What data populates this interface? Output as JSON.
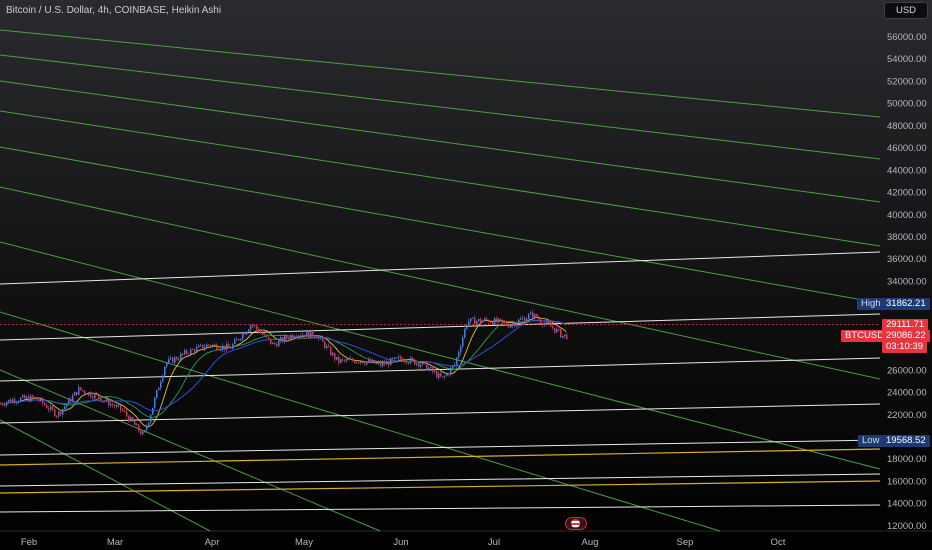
{
  "header": {
    "title": "Bitcoin / U.S. Dollar, 4h, COINBASE, Heikin Ashi",
    "currency_button": "USD"
  },
  "tags": {
    "high_label": "High",
    "high_value": "31862.21",
    "low_label": "Low",
    "low_value": "19568.52",
    "symbol": "BTCUSD",
    "price_a": "29111.71",
    "price_b": "29086.22",
    "countdown": "03:10:39"
  },
  "colors": {
    "background": "#000000",
    "up": "#3f7cf4",
    "down": "#e0304a",
    "trendline_green": "#58b44b",
    "level_white": "#e8e8e8",
    "level_yellow": "#d8b024",
    "ma_fast": "#e3c53a",
    "ma_slow": "#2c4fd8",
    "ma_mid": "#2e9c4d",
    "price_tag": "#e8343f",
    "extreme_tag": "#1e3a74"
  },
  "chart_data": {
    "type": "line",
    "title": "Bitcoin / U.S. Dollar, 4h, COINBASE, Heikin Ashi",
    "x_ticks": [
      "Feb",
      "Mar",
      "Apr",
      "May",
      "Jun",
      "Jul",
      "Aug",
      "Sep",
      "Oct"
    ],
    "y_ticks": [
      "56000.00",
      "54000.00",
      "52000.00",
      "50000.00",
      "48000.00",
      "46000.00",
      "44000.00",
      "42000.00",
      "40000.00",
      "38000.00",
      "36000.00",
      "34000.00",
      "26000.00",
      "24000.00",
      "22000.00",
      "18000.00",
      "16000.00",
      "14000.00",
      "12000.00"
    ],
    "ylim": [
      11500,
      57500
    ],
    "series": [
      {
        "name": "BTCUSD",
        "x": [
          "2023-01-20",
          "2023-01-27",
          "2023-02-03",
          "2023-02-10",
          "2023-02-17",
          "2023-02-24",
          "2023-03-03",
          "2023-03-10",
          "2023-03-13",
          "2023-03-17",
          "2023-03-24",
          "2023-03-31",
          "2023-04-07",
          "2023-04-14",
          "2023-04-21",
          "2023-04-28",
          "2023-05-05",
          "2023-05-12",
          "2023-05-19",
          "2023-05-26",
          "2023-06-02",
          "2023-06-09",
          "2023-06-15",
          "2023-06-19",
          "2023-06-23",
          "2023-06-30",
          "2023-07-07",
          "2023-07-14",
          "2023-07-21",
          "2023-07-24"
        ],
        "y": [
          22800,
          23400,
          23500,
          22000,
          24300,
          23500,
          22400,
          20100,
          22800,
          26600,
          27600,
          28300,
          28000,
          30200,
          28300,
          29300,
          29200,
          26800,
          26900,
          26500,
          27100,
          26500,
          25200,
          26500,
          30400,
          30500,
          30100,
          31000,
          29800,
          29100
        ]
      }
    ],
    "extremes": {
      "high": 31862.21,
      "low": 19568.52
    },
    "last_price": [
      29111.71,
      29086.22
    ]
  }
}
